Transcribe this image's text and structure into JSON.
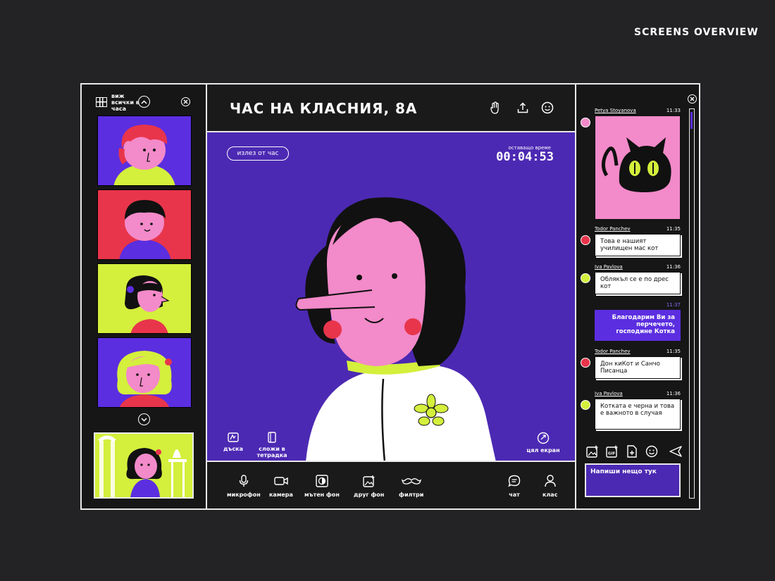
{
  "screens_overview": "SCREENS OVERVIEW",
  "sidebar": {
    "view_all_label": "виж всички в часа"
  },
  "header": {
    "title": "ЧАС НА КЛАСНИЯ, 8А"
  },
  "video": {
    "leave_button": "излез от час",
    "timer_label": "оставащо време",
    "timer_value": "00:04:53",
    "tools": {
      "board": "дъска",
      "notebook": "сложи в тетрадка",
      "fullscreen": "цял екран"
    }
  },
  "toolbar": {
    "microphone": "микрофон",
    "camera": "камера",
    "blur_bg": "мътен фон",
    "other_bg": "друг фон",
    "filters": "филтри",
    "chat": "чат",
    "class": "клас"
  },
  "chat": {
    "messages": [
      {
        "name": "Petya Stoyanova",
        "time": "11:33",
        "kind": "image"
      },
      {
        "name": "Todor Panchev",
        "time": "11:35",
        "text": "Това е нашият училищен мас кот"
      },
      {
        "name": "Iva Pavlova",
        "time": "11:36",
        "text": "Облякъл се е по дрес кот"
      },
      {
        "name": "",
        "time": "11:37",
        "text": "Благодарим Ви за перчечето, господине Котка",
        "own": true
      },
      {
        "name": "Todor Panchev",
        "time": "11:35",
        "text": "Дон киКот и Санчо Писанца"
      },
      {
        "name": "Iva Pavlova",
        "time": "11:36",
        "text": "Котката е черна и това е важното в случая"
      }
    ],
    "input_placeholder": "Напиши нещо тук"
  },
  "colors": {
    "purple": "#4c29b3",
    "lime": "#d4ef3c",
    "pink": "#f38ac9",
    "red": "#e8354b"
  }
}
